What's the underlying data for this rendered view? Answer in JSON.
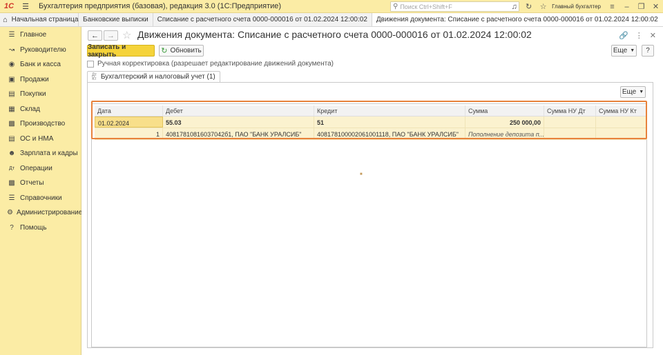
{
  "app": {
    "logo": "1С",
    "title": "Бухгалтерия предприятия (базовая), редакция 3.0  (1С:Предприятие)",
    "search_placeholder": "Поиск Ctrl+Shift+F",
    "user": "Главный бухгалтер"
  },
  "tabs": [
    {
      "label": "Начальная страница"
    },
    {
      "label": "Банковские выписки"
    },
    {
      "label": "Списание с расчетного счета 0000-000016 от 01.02.2024 12:00:02"
    },
    {
      "label": "Движения документа: Списание с расчетного счета 0000-000016 от 01.02.2024 12:00:02"
    }
  ],
  "sidebar": {
    "items": [
      {
        "label": "Главное",
        "icon": "menu-icon"
      },
      {
        "label": "Руководителю",
        "icon": "chart-line-icon"
      },
      {
        "label": "Банк и касса",
        "icon": "bank-icon"
      },
      {
        "label": "Продажи",
        "icon": "sales-icon"
      },
      {
        "label": "Покупки",
        "icon": "purchases-icon"
      },
      {
        "label": "Склад",
        "icon": "warehouse-icon"
      },
      {
        "label": "Производство",
        "icon": "production-icon"
      },
      {
        "label": "ОС и НМА",
        "icon": "assets-icon"
      },
      {
        "label": "Зарплата и кадры",
        "icon": "people-icon"
      },
      {
        "label": "Операции",
        "icon": "operations-icon"
      },
      {
        "label": "Отчеты",
        "icon": "reports-icon"
      },
      {
        "label": "Справочники",
        "icon": "books-icon"
      },
      {
        "label": "Администрирование",
        "icon": "gear-icon"
      },
      {
        "label": "Помощь",
        "icon": "help-icon"
      }
    ]
  },
  "document": {
    "title": "Движения документа: Списание с расчетного счета 0000-000016 от 01.02.2024 12:00:02",
    "save_close_label": "Записать и закрыть",
    "refresh_label": "Обновить",
    "more_label": "Еще",
    "help_label": "?",
    "manual_label": "Ручная корректировка (разрешает редактирование движений документа)",
    "subtab_label": "Бухгалтерский и налоговый учет (1)",
    "table_more_label": "Еще"
  },
  "table": {
    "columns": [
      "Дата",
      "Дебет",
      "Кредит",
      "Сумма",
      "Сумма НУ Дт",
      "Сумма НУ Кт"
    ],
    "rows": [
      {
        "date": "01.02.2024",
        "debit": "55.03",
        "credit": "51",
        "sum": "250 000,00",
        "nu_dt": "",
        "nu_kt": ""
      },
      {
        "date": "1",
        "debit": "40817810816037042б1, ПАО \"БАНК УРАЛСИБ\"",
        "credit": "408178100002061001118, ПАО \"БАНК УРАЛСИБ\"",
        "sum": "Пополнение депозита п...",
        "nu_dt": "",
        "nu_kt": ""
      }
    ]
  }
}
